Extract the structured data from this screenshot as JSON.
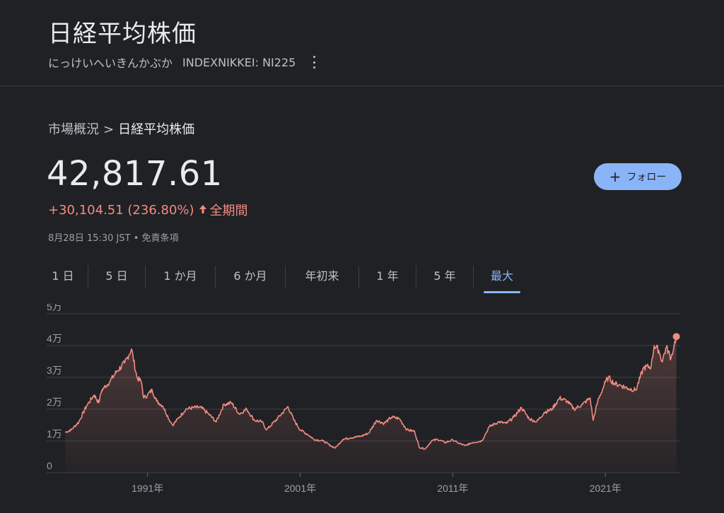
{
  "header": {
    "title": "日経平均株価",
    "reading": "にっけいへいきんかぶか",
    "ticker": "INDEXNIKKEI: NI225"
  },
  "breadcrumb": {
    "parent": "市場概況",
    "separator": ">",
    "current": "日経平均株価"
  },
  "quote": {
    "price": "42,817.61",
    "change": "+30,104.51 (236.80%)",
    "period": "全期間",
    "timestamp": "8月28日 15:30 JST • 免責条項"
  },
  "follow_button": {
    "label": "フォロー"
  },
  "tabs": [
    {
      "label": "1 日"
    },
    {
      "label": "5 日"
    },
    {
      "label": "1 か月"
    },
    {
      "label": "6 か月"
    },
    {
      "label": "年初来"
    },
    {
      "label": "1 年"
    },
    {
      "label": "5 年"
    },
    {
      "label": "最大",
      "active": true
    }
  ],
  "colors": {
    "background": "#202124",
    "line": "#f28b82",
    "accent": "#8ab4f8",
    "positive_change": "#f28b82"
  },
  "chart_data": {
    "type": "line",
    "ylabels": [
      "5万",
      "4万",
      "3万",
      "2万",
      "1万",
      "0"
    ],
    "yticks": [
      50000,
      40000,
      30000,
      20000,
      10000,
      0
    ],
    "ylim": [
      0,
      50000
    ],
    "xlabels": [
      "1991年",
      "2001年",
      "2011年",
      "2021年"
    ],
    "xticks": [
      1991,
      2001,
      2011,
      2021
    ],
    "xlim": [
      1985.5,
      2025.9
    ],
    "grid": true,
    "series": [
      {
        "x": [
          1985.6,
          1986.0,
          1986.5,
          1987.0,
          1987.5,
          1987.8,
          1988.0,
          1988.5,
          1989.0,
          1989.5,
          1989.95,
          1990.3,
          1990.6,
          1990.75,
          1991.0,
          1991.3,
          1991.6,
          1992.0,
          1992.5,
          1992.65,
          1993.0,
          1993.5,
          1994.0,
          1994.5,
          1995.0,
          1995.5,
          1996.0,
          1996.5,
          1997.0,
          1997.5,
          1998.0,
          1998.5,
          1998.8,
          1999.5,
          2000.2,
          2000.6,
          2001.0,
          2001.5,
          2001.9,
          2002.5,
          2003.0,
          2003.3,
          2003.8,
          2004.3,
          2005.0,
          2005.5,
          2006.0,
          2006.5,
          2007.0,
          2007.5,
          2008.0,
          2008.5,
          2008.8,
          2009.2,
          2009.6,
          2010.0,
          2010.5,
          2011.0,
          2011.3,
          2011.8,
          2012.3,
          2012.9,
          2013.4,
          2014.0,
          2014.5,
          2015.0,
          2015.5,
          2016.0,
          2016.5,
          2017.0,
          2017.5,
          2018.0,
          2018.5,
          2018.95,
          2019.5,
          2020.0,
          2020.2,
          2020.5,
          2021.0,
          2021.2,
          2021.6,
          2022.0,
          2022.5,
          2023.0,
          2023.5,
          2024.0,
          2024.2,
          2024.5,
          2024.7,
          2025.0,
          2025.3,
          2025.5,
          2025.65
        ],
        "values": [
          12713,
          13500,
          16000,
          21000,
          24500,
          22000,
          26000,
          28500,
          32000,
          34500,
          38915,
          30000,
          28500,
          23500,
          24500,
          26000,
          22500,
          21000,
          16000,
          15000,
          17000,
          20000,
          20500,
          20500,
          18500,
          16000,
          21500,
          22000,
          18500,
          20000,
          16500,
          16000,
          13500,
          17000,
          20800,
          16500,
          13500,
          12000,
          10500,
          10000,
          8500,
          7800,
          10500,
          11000,
          11500,
          12500,
          16500,
          15500,
          17500,
          17000,
          13500,
          13000,
          8000,
          7500,
          10000,
          10500,
          9500,
          10300,
          9500,
          8500,
          9500,
          10000,
          14500,
          16000,
          15500,
          17500,
          20500,
          17000,
          16000,
          19000,
          20000,
          23500,
          22500,
          20000,
          21500,
          23500,
          16500,
          22500,
          28500,
          30000,
          28000,
          27500,
          26500,
          26000,
          33000,
          33500,
          40000,
          38500,
          35000,
          39500,
          36000,
          40000,
          42817
        ]
      }
    ],
    "last_value": 42817.61
  }
}
